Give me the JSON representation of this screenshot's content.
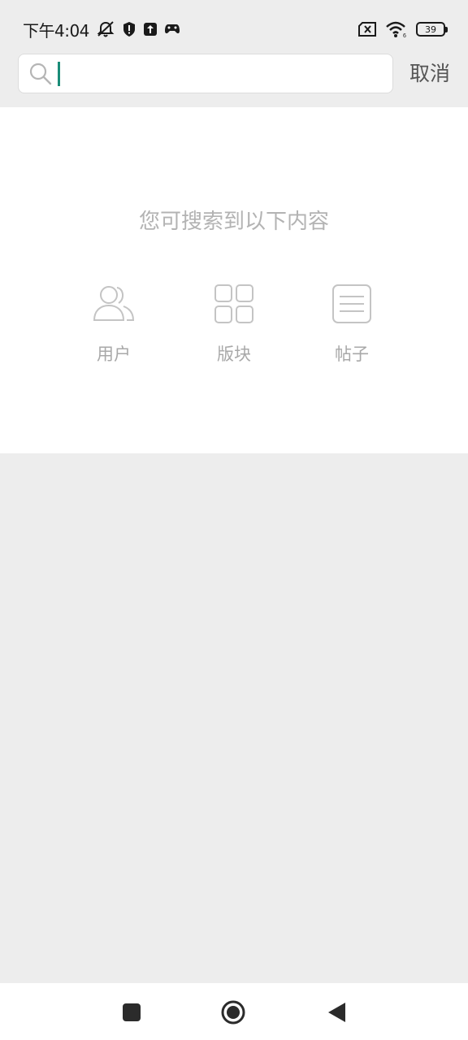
{
  "status_bar": {
    "time": "下午4:04",
    "battery_level": "39",
    "icons": [
      "bell-off-icon",
      "shield-alert-icon",
      "upload-icon",
      "gamepad-icon",
      "sim-x-icon",
      "wifi-icon",
      "battery-icon"
    ]
  },
  "search": {
    "value": "",
    "placeholder": "",
    "cancel_label": "取消"
  },
  "content": {
    "hint": "您可搜索到以下内容",
    "categories": [
      {
        "label": "用户",
        "icon": "users-icon"
      },
      {
        "label": "版块",
        "icon": "grid-icon"
      },
      {
        "label": "帖子",
        "icon": "document-icon"
      }
    ]
  },
  "nav_bar": {
    "icons": [
      "recents-square-icon",
      "home-circle-icon",
      "back-triangle-icon"
    ]
  },
  "colors": {
    "accent_caret": "#1a8c78",
    "background": "#ededed",
    "panel": "#ffffff",
    "hint_text": "#b3b3b3",
    "icon_gray": "#c4c4c4"
  }
}
